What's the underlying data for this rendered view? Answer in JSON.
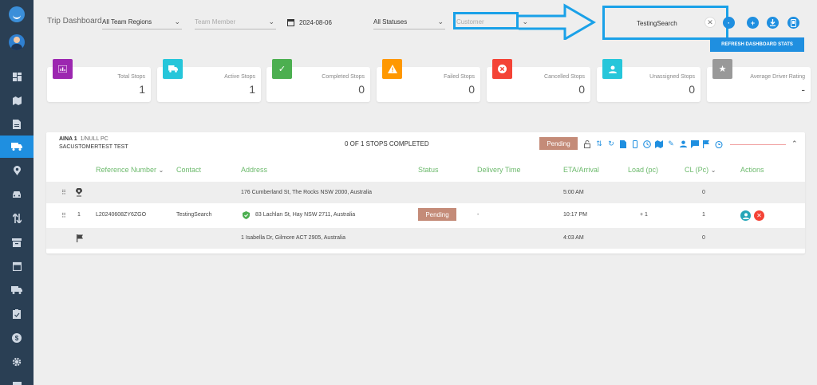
{
  "sidebar": {
    "items": [
      "dashboard-icon",
      "map-icon",
      "document-icon",
      "truck-icon",
      "location-pin-icon",
      "car-icon",
      "swap-icon",
      "archive-icon",
      "calendar-icon",
      "delivery-truck-icon",
      "clipboard-icon",
      "dollar-icon",
      "gear-icon",
      "more-icon"
    ],
    "active_index": 3
  },
  "header": {
    "title": "Trip Dashboard",
    "region_select": "All Team Regions",
    "member_placeholder": "Team Member",
    "date": "2024-08-06",
    "status_select": "All Statuses",
    "customer_placeholder": "Customer",
    "search_value": "TestingSearch",
    "refresh_label": "REFRESH DASHBOARD STATS"
  },
  "stats": [
    {
      "label": "Total Stops",
      "value": "1",
      "color": "#9c27b0",
      "icon": "chart-icon"
    },
    {
      "label": "Active Stops",
      "value": "1",
      "color": "#26c6da",
      "icon": "truck-icon"
    },
    {
      "label": "Completed Stops",
      "value": "0",
      "color": "#4caf50",
      "icon": "check-icon"
    },
    {
      "label": "Failed Stops",
      "value": "0",
      "color": "#ff9800",
      "icon": "warning-icon"
    },
    {
      "label": "Cancelled Stops",
      "value": "0",
      "color": "#f44336",
      "icon": "cancel-icon"
    },
    {
      "label": "Unassigned Stops",
      "value": "0",
      "color": "#26c6da",
      "icon": "person-icon"
    },
    {
      "label": "Average Driver Rating",
      "value": "-",
      "color": "#999999",
      "icon": "star-icon"
    }
  ],
  "route": {
    "name": "AINA 1",
    "sub": "1/NULL PC",
    "customer": "SACUSTOMERTEST TEST",
    "progress": "0 OF 1 STOPS COMPLETED",
    "status": "Pending"
  },
  "table": {
    "headers": {
      "reference": "Reference Number",
      "contact": "Contact",
      "address": "Address",
      "status": "Status",
      "delivery_time": "Delivery Time",
      "eta": "ETA/Arrival",
      "load": "Load (pc)",
      "cl": "CL (Pc)",
      "actions": "Actions"
    },
    "rows": [
      {
        "index": "",
        "reference": "",
        "contact": "",
        "address": "176 Cumberland St, The Rocks NSW 2000, Australia",
        "status": "",
        "delivery_time": "",
        "eta": "5:00 AM",
        "load": "",
        "cl": "0",
        "icon": "location-pin-icon"
      },
      {
        "index": "1",
        "reference": "L20240608ZY6ZGO",
        "contact": "TestingSearch",
        "address": "83 Lachlan St, Hay NSW 2711, Australia",
        "status": "Pending",
        "delivery_time": "-",
        "eta": "10:17 PM",
        "load": "+ 1",
        "cl": "1",
        "icon": "shield-check-icon"
      },
      {
        "index": "",
        "reference": "",
        "contact": "",
        "address": "1 Isabella Dr, Gilmore ACT 2905, Australia",
        "status": "",
        "delivery_time": "",
        "eta": "4:03 AM",
        "load": "",
        "cl": "0",
        "icon": "flag-icon"
      }
    ]
  }
}
